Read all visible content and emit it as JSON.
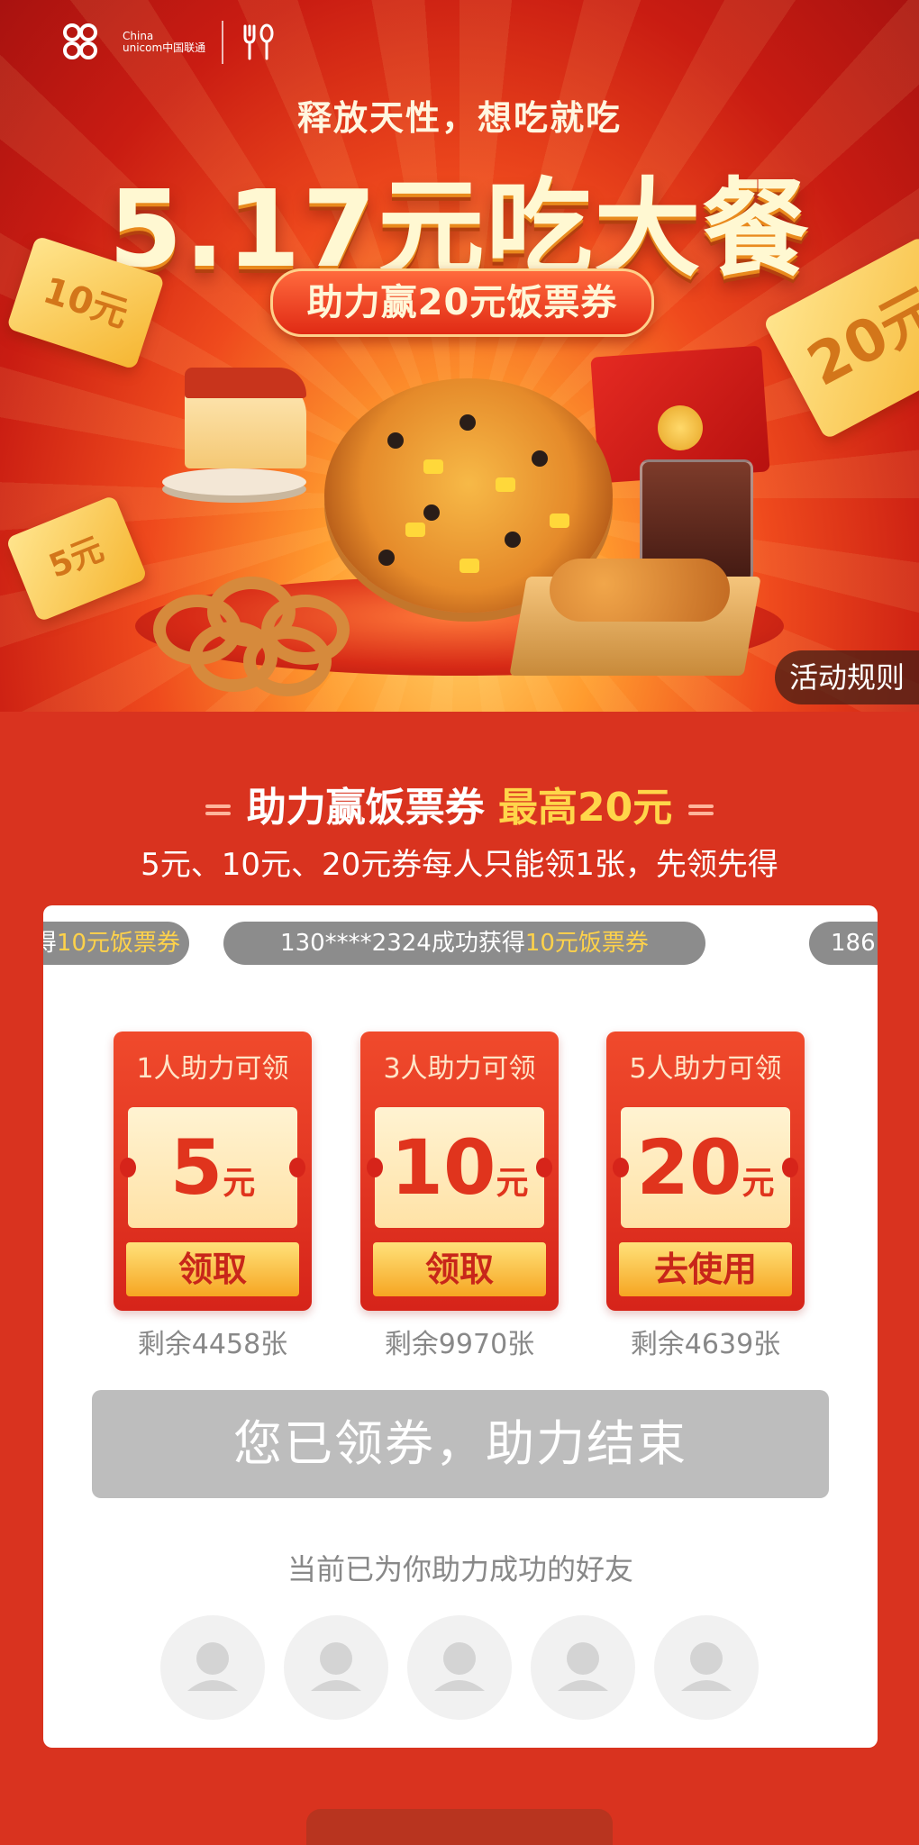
{
  "brand": {
    "line1": "China",
    "line2": "unicom中国联通"
  },
  "hero": {
    "slogan": "释放天性，想吃就吃",
    "headline": "5.17元吃大餐",
    "subtitle": "助力赢20元饭票券",
    "tickets": [
      "10元",
      "20元",
      "5元"
    ],
    "rules_label": "活动规则"
  },
  "promo": {
    "title_main": "助力赢饭票券",
    "title_highlight": "最高20元",
    "subtitle": "5元、10元、20元券每人只能领1张，先领先得"
  },
  "ticker": [
    {
      "prefix": "得",
      "highlight": "10元饭票券",
      "suffix": ""
    },
    {
      "prefix": "130****2324成功获得",
      "highlight": "10元饭票券",
      "suffix": ""
    },
    {
      "prefix": "186",
      "highlight": "",
      "suffix": ""
    }
  ],
  "tiers": [
    {
      "condition": "1人助力可领",
      "amount": "5",
      "unit": "元",
      "button": "领取",
      "remaining": "剩余4458张"
    },
    {
      "condition": "3人助力可领",
      "amount": "10",
      "unit": "元",
      "button": "领取",
      "remaining": "剩余9970张"
    },
    {
      "condition": "5人助力可领",
      "amount": "20",
      "unit": "元",
      "button": "去使用",
      "remaining": "剩余4639张"
    }
  ],
  "status_button": "您已领券，助力结束",
  "helped_label": "当前已为你助力成功的好友",
  "colors": {
    "primary_red": "#d9331f",
    "gold": "#ffd64a",
    "disabled_gray": "#bdbdbd"
  },
  "avatars": [
    "user-avatar-placeholder",
    "user-avatar-placeholder",
    "user-avatar-placeholder",
    "user-avatar-placeholder",
    "user-avatar-placeholder"
  ]
}
